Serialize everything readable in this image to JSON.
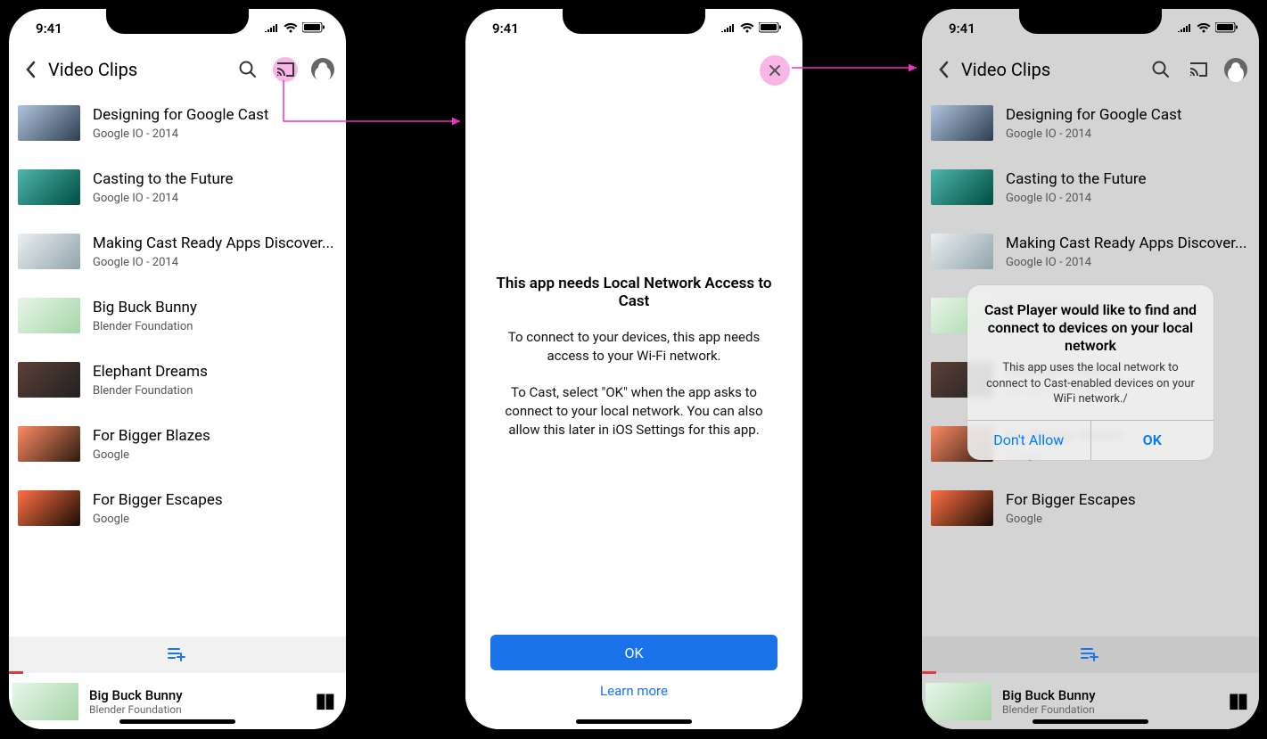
{
  "status": {
    "time": "9:41"
  },
  "header": {
    "title": "Video Clips"
  },
  "videos": [
    {
      "title": "Designing for Google Cast",
      "subtitle": "Google IO - 2014"
    },
    {
      "title": "Casting to the Future",
      "subtitle": "Google IO - 2014"
    },
    {
      "title": "Making Cast Ready Apps Discover...",
      "subtitle": "Google IO - 2014"
    },
    {
      "title": "Big Buck Bunny",
      "subtitle": "Blender Foundation"
    },
    {
      "title": "Elephant Dreams",
      "subtitle": "Blender Foundation"
    },
    {
      "title": "For Bigger Blazes",
      "subtitle": "Google"
    },
    {
      "title": "For Bigger Escapes",
      "subtitle": "Google"
    }
  ],
  "miniplayer": {
    "title": "Big Buck Bunny",
    "subtitle": "Blender Foundation"
  },
  "accessModal": {
    "title": "This app needs Local Network Access to Cast",
    "p1": "To connect to your devices, this app needs access to your Wi-Fi network.",
    "p2": "To Cast, select \"OK\" when the app asks to connect to your local network. You can also allow this later in iOS Settings for this app.",
    "ok": "OK",
    "learn": "Learn more"
  },
  "iosAlert": {
    "title": "Cast Player would like to find and connect to devices on your local network",
    "message": "This app uses the local network to connect to Cast-enabled devices on your WiFi network./",
    "deny": "Don't Allow",
    "allow": "OK"
  },
  "colors": {
    "accent": "#1a73e8",
    "iosBlue": "#007aff",
    "highlight": "#f7b6e6",
    "flowArrow": "#e933c3"
  }
}
